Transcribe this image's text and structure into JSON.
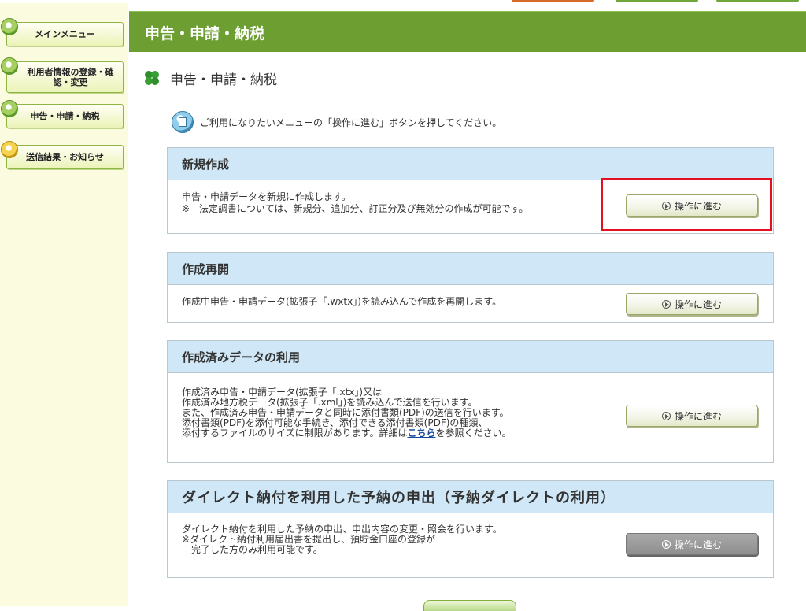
{
  "sidebar": {
    "items": [
      {
        "label": "メインメニュー"
      },
      {
        "label": "利用者情報の登録・確認・変更"
      },
      {
        "label": "申告・申請・納税"
      },
      {
        "label": "送信結果・お知らせ"
      }
    ]
  },
  "header": {
    "title": "申告・申請・納税"
  },
  "page": {
    "title": "申告・申請・納税",
    "instruction": "ご利用になりたいメニューの「操作に進む」ボタンを押してください。"
  },
  "panels": [
    {
      "title": "新規作成",
      "lines": [
        "申告・申請データを新規に作成します。",
        "※　法定調書については、新規分、追加分、訂正分及び無効分の作成が可能です。"
      ],
      "button": "操作に進む"
    },
    {
      "title": "作成再開",
      "lines": [
        "作成中申告・申請データ(拡張子「.wxtx」)を読み込んで作成を再開します。"
      ],
      "button": "操作に進む"
    },
    {
      "title": "作成済みデータの利用",
      "lines": [
        "作成済み申告・申請データ(拡張子「.xtx」)又は",
        "作成済み地方税データ(拡張子「.xml」)を読み込んで送信を行います。",
        "また、作成済み申告・申請データと同時に添付書類(PDF)の送信を行います。",
        "添付書類(PDF)を添付可能な手続き、添付できる添付書類(PDF)の種類、",
        "添付するファイルのサイズに制限があります。詳細は",
        "こちら",
        "を参照ください。"
      ],
      "button": "操作に進む"
    },
    {
      "title": "ダイレクト納付を利用した予納の申出（予納ダイレクトの利用）",
      "lines": [
        "ダイレクト納付を利用した予納の申出、申出内容の変更・照会を行います。",
        "※ダイレクト納付利用届出書を提出し、預貯金口座の登録が",
        "　完了した方のみ利用可能です。"
      ],
      "button": "操作に進む"
    }
  ],
  "colors": {
    "header_green": "#6c9e32",
    "panel_header_blue": "#cfe7f6",
    "highlight_red": "#e3101f",
    "disabled_gray": "#8e8e8e"
  }
}
